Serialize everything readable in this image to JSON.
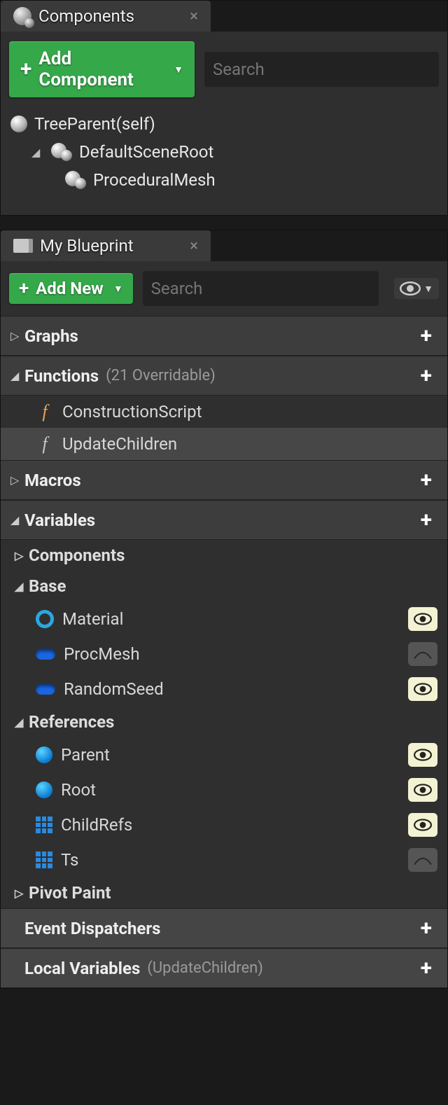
{
  "componentsPanel": {
    "tabTitle": "Components",
    "addButton": "Add Component",
    "searchPlaceholder": "Search",
    "tree": {
      "root": "TreeParent(self)",
      "sceneRoot": "DefaultSceneRoot",
      "child": "ProceduralMesh"
    }
  },
  "blueprintPanel": {
    "tabTitle": "My Blueprint",
    "addButton": "Add New",
    "searchPlaceholder": "Search",
    "sections": {
      "graphs": {
        "label": "Graphs"
      },
      "functions": {
        "label": "Functions",
        "meta": "(21 Overridable)",
        "items": [
          {
            "label": "ConstructionScript",
            "iconColor": "orange"
          },
          {
            "label": "UpdateChildren",
            "iconColor": "gray",
            "highlight": true
          }
        ]
      },
      "macros": {
        "label": "Macros"
      },
      "variables": {
        "label": "Variables",
        "groups": [
          {
            "label": "Components",
            "expanded": false
          },
          {
            "label": "Base",
            "expanded": true,
            "items": [
              {
                "label": "Material",
                "icon": "ring",
                "visible": true
              },
              {
                "label": "ProcMesh",
                "icon": "pill",
                "visible": false
              },
              {
                "label": "RandomSeed",
                "icon": "pill",
                "visible": true
              }
            ]
          },
          {
            "label": "References",
            "expanded": true,
            "items": [
              {
                "label": "Parent",
                "icon": "ball",
                "visible": true
              },
              {
                "label": "Root",
                "icon": "ball",
                "visible": true
              },
              {
                "label": "ChildRefs",
                "icon": "grid",
                "visible": true
              },
              {
                "label": "Ts",
                "icon": "grid",
                "visible": false
              }
            ]
          },
          {
            "label": "Pivot Paint",
            "expanded": false
          }
        ]
      },
      "eventDispatchers": {
        "label": "Event Dispatchers"
      },
      "localVariables": {
        "label": "Local Variables",
        "meta": "(UpdateChildren)"
      }
    }
  }
}
